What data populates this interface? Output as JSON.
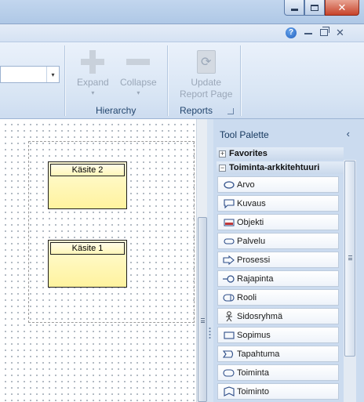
{
  "window": {
    "min_icon": "minimize-icon",
    "max_icon": "maximize-icon",
    "close_glyph": "✕"
  },
  "ribbon_controls": {
    "help": "?",
    "help_icon": "help-icon"
  },
  "ribbon": {
    "hierarchy": {
      "label": "Hierarchy",
      "expand": {
        "label": "Expand",
        "icon": "plus-icon",
        "drop": "▾"
      },
      "collapse": {
        "label": "Collapse",
        "icon": "minus-icon",
        "drop": "▾"
      }
    },
    "reports": {
      "label": "Reports",
      "update_line1": "Update",
      "update_line2": "Report Page",
      "icon": "refresh-icon"
    },
    "combo_arrow": "▾"
  },
  "canvas": {
    "concepts": [
      {
        "label": "Käsite 2"
      },
      {
        "label": "Käsite 1"
      }
    ]
  },
  "palette": {
    "title": "Tool Palette",
    "collapse_glyph": "‹",
    "sections": [
      {
        "label": "Favorites",
        "expander": "+"
      },
      {
        "label": "Toiminta-arkkitehtuuri",
        "expander": "−"
      }
    ],
    "items": [
      {
        "label": "Arvo",
        "icon": "ellipse-icon"
      },
      {
        "label": "Kuvaus",
        "icon": "callout-icon"
      },
      {
        "label": "Objekti",
        "icon": "object-icon"
      },
      {
        "label": "Palvelu",
        "icon": "rounded-rect-icon"
      },
      {
        "label": "Prosessi",
        "icon": "arrow-shape-icon"
      },
      {
        "label": "Rajapinta",
        "icon": "interface-icon"
      },
      {
        "label": "Rooli",
        "icon": "role-icon"
      },
      {
        "label": "Sidosryhmä",
        "icon": "stakeholder-icon"
      },
      {
        "label": "Sopimus",
        "icon": "contract-icon"
      },
      {
        "label": "Tapahtuma",
        "icon": "event-icon"
      },
      {
        "label": "Toiminta",
        "icon": "function-icon"
      },
      {
        "label": "Toiminto",
        "icon": "activity-icon"
      }
    ]
  },
  "colors": {
    "concept_fill": "#fff39e",
    "ribbon_bg": "#dfe9f5",
    "palette_bg": "#cbdbef",
    "close_red": "#c7432a"
  }
}
